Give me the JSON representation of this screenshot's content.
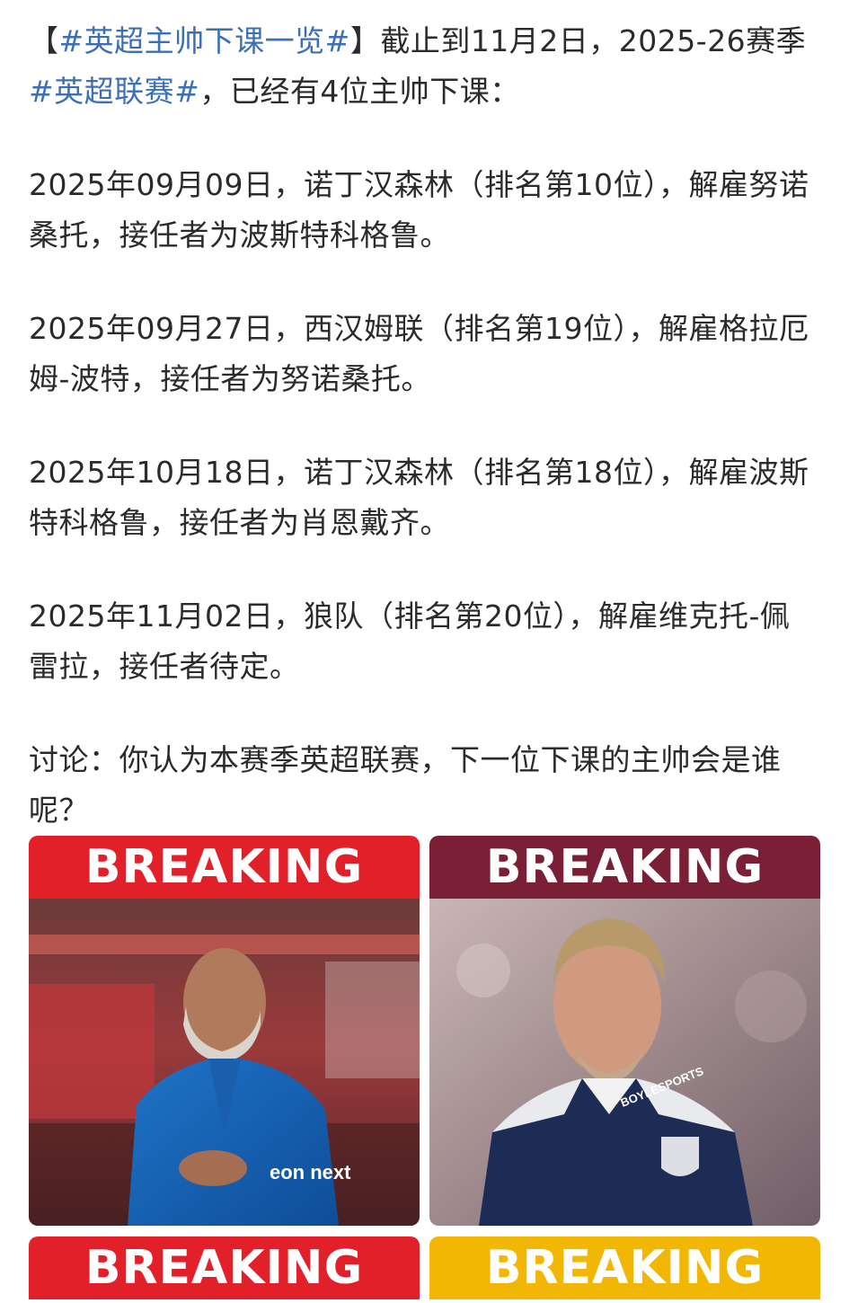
{
  "post": {
    "intro_bracket_open": "【",
    "intro_tag1": "#英超主帅下课一览#",
    "intro_after_tag1": "】截止到11月2日，2025-26赛季",
    "intro_tag2": "#英超联赛#",
    "intro_after_tag2": "，已经有4位主帅下课：",
    "entries": [
      "2025年09月09日，诺丁汉森林（排名第10位），解雇努诺桑托，接任者为波斯特科格鲁。",
      "2025年09月27日，西汉姆联（排名第19位），解雇格拉厄姆-波特，接任者为努诺桑托。",
      "2025年10月18日，诺丁汉森林（排名第18位），解雇波斯特科格鲁，接任者为肖恩戴齐。",
      "2025年11月02日，狼队（排名第20位），解雇维克托-佩雷拉，接任者待定。"
    ],
    "discussion": "讨论：你认为本赛季英超联赛，下一位下课的主帅会是谁呢？"
  },
  "images": [
    {
      "banner": "BREAKING",
      "banner_color": "#e2202a",
      "jersey_text": "eon next"
    },
    {
      "banner": "BREAKING",
      "banner_color": "#7a1f35",
      "jersey_text": "BOYLESPORTS"
    },
    {
      "banner": "BREAKING",
      "banner_color": "#e2202a"
    },
    {
      "banner": "BREAKING",
      "banner_color": "#f2b705"
    }
  ],
  "colors": {
    "text": "#2b2b2b",
    "hashtag": "#3d6fb6"
  }
}
